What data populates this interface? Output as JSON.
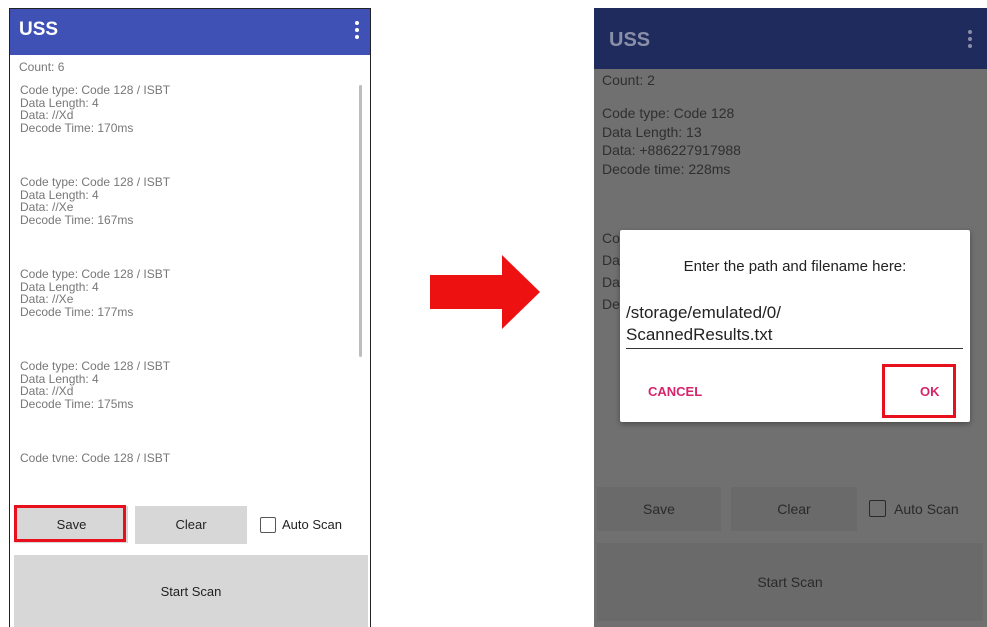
{
  "left": {
    "app_title": "USS",
    "count_text": "Count:  6",
    "records": [
      [
        "Code type: Code 128 / ISBT",
        "Data Length: 4",
        "Data: //Xd",
        "Decode Time: 170ms"
      ],
      [
        "Code type: Code 128 / ISBT",
        "Data Length: 4",
        "Data: //Xe",
        "Decode Time: 167ms"
      ],
      [
        "Code type: Code 128 / ISBT",
        "Data Length: 4",
        "Data: //Xe",
        "Decode Time: 177ms"
      ],
      [
        "Code type: Code 128 / ISBT",
        "Data Length: 4",
        "Data: //Xd",
        "Decode Time: 175ms"
      ],
      [
        "Code tvne: Code 128 / ISBT",
        "",
        "",
        ""
      ]
    ],
    "save_label": "Save",
    "clear_label": "Clear",
    "auto_scan_label": "Auto Scan",
    "start_scan_label": "Start Scan",
    "highlight_color": "#e8101c"
  },
  "right": {
    "app_title": "USS",
    "count_text": "Count:  2",
    "record": [
      "Code type: Code 128",
      "Data Length: 13",
      "Data: +886227917988",
      "Decode time: 228ms"
    ],
    "partial_lines": [
      "Co",
      "Da",
      "Da",
      "De"
    ],
    "dialog": {
      "message": "Enter the path and filename here:",
      "path_line1": "/storage/emulated/0/",
      "path_line2": "ScannedResults.txt",
      "cancel_label": "CANCEL",
      "ok_label": "OK"
    },
    "save_label": "Save",
    "clear_label": "Clear",
    "auto_scan_label": "Auto Scan",
    "start_scan_label": "Start Scan"
  },
  "colors": {
    "appbar": "#3f51b5",
    "appbar_dimmed": "#1e2b5c",
    "dialog_button": "#d6256a",
    "arrow": "#ee1111"
  }
}
